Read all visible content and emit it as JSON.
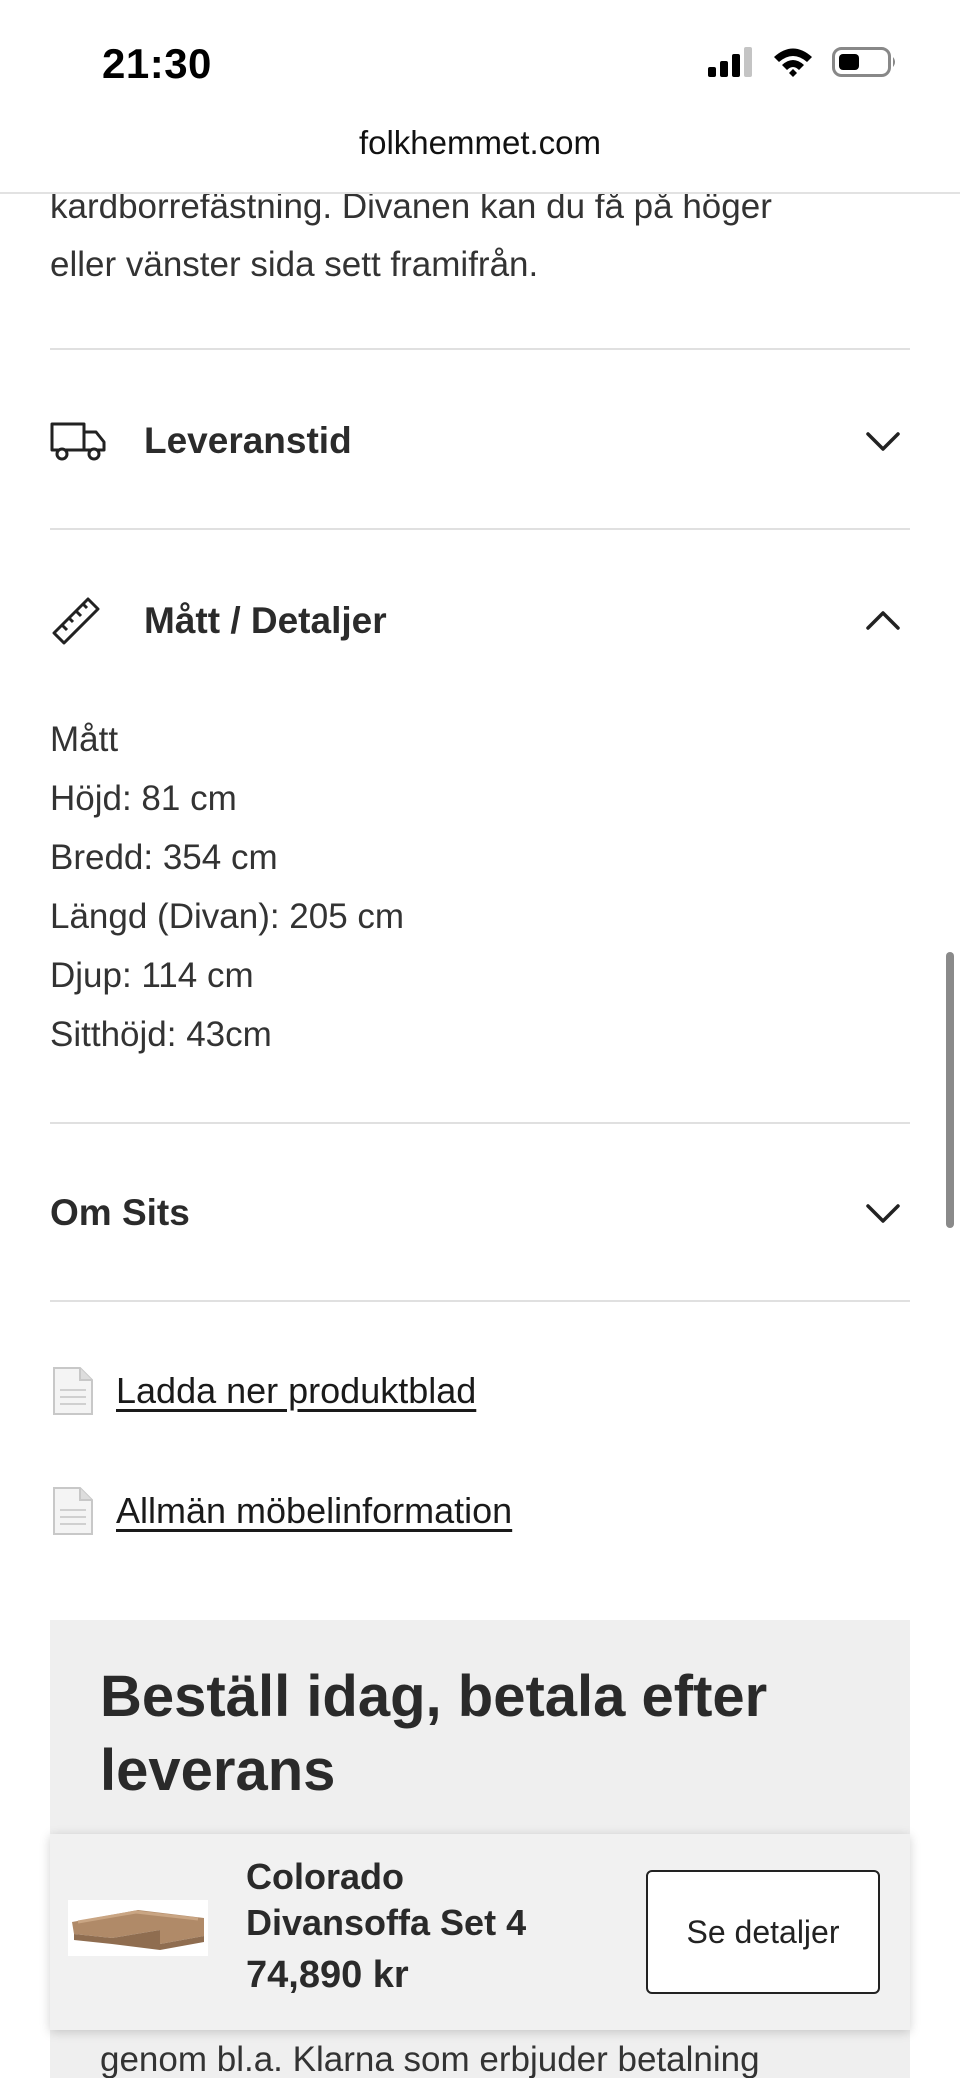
{
  "status_bar": {
    "time": "21:30",
    "icons": [
      "cellular-signal-icon",
      "wifi-icon",
      "battery-icon"
    ]
  },
  "browser": {
    "url": "folkhemmet.com"
  },
  "description": {
    "line1": "kardborrefästning. Divanen kan du få på höger",
    "line2": "eller vänster sida sett framifrån."
  },
  "accordion": {
    "delivery": {
      "title": "Leveranstid",
      "icon": "truck-icon",
      "state": "collapsed"
    },
    "dimensions": {
      "title": "Mått / Detaljer",
      "icon": "ruler-icon",
      "state": "expanded"
    },
    "seat": {
      "title": "Om Sits",
      "state": "collapsed"
    }
  },
  "specs": {
    "heading": "Mått",
    "height": "Höjd: 81 cm",
    "width": "Bredd: 354 cm",
    "length": "Längd (Divan): 205 cm",
    "depth": "Djup: 114 cm",
    "seat_height": "Sitthöjd: 43cm"
  },
  "links": {
    "product_sheet": "Ladda ner produktblad",
    "furniture_info": "Allmän möbelinformation"
  },
  "promo": {
    "title": "Beställ idag, betala efter leverans",
    "tail": "genom bl.a. Klarna som erbjuder betalning"
  },
  "sticky_product": {
    "name_line1": "Colorado",
    "name_line2": "Divansoffa Set 4",
    "price": "74,890 kr",
    "button_label": "Se detaljer"
  },
  "colors": {
    "text": "#222222",
    "divider": "#e0e0e0",
    "promo_bg": "#efefef",
    "sofa": "#b08a68"
  }
}
